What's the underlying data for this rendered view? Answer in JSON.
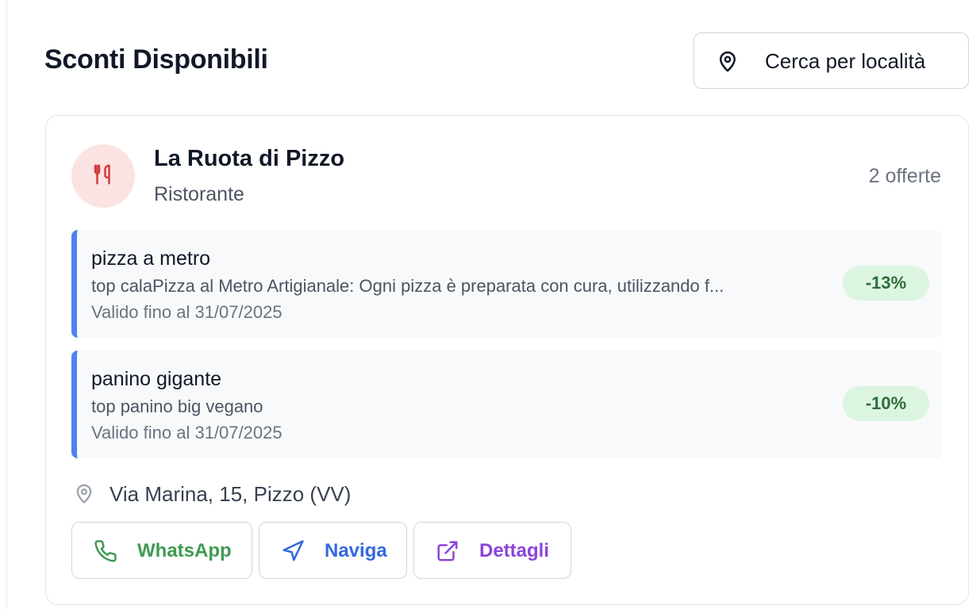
{
  "header": {
    "title": "Sconti Disponibili",
    "location_button_label": "Cerca per località"
  },
  "restaurant": {
    "name": "La Ruota di Pizzo",
    "type": "Ristorante",
    "offers_count": "2 offerte",
    "icon": "fork-knife-icon",
    "avatar_bg": "#fbe3e3",
    "icon_color": "#d33a3a"
  },
  "offers": [
    {
      "title": "pizza a metro",
      "description": "top calaPizza al Metro Artigianale: Ogni pizza è preparata con cura, utilizzando f...",
      "valid": "Valido fino al 31/07/2025",
      "discount": "-13%"
    },
    {
      "title": "panino gigante",
      "description": "top panino big vegano",
      "valid": "Valido fino al 31/07/2025",
      "discount": "-10%"
    }
  ],
  "address": "Via Marina, 15, Pizzo (VV)",
  "actions": {
    "whatsapp": {
      "label": "WhatsApp",
      "color": "#3f9a52",
      "icon": "phone-icon"
    },
    "navigate": {
      "label": "Naviga",
      "color": "#3468e0",
      "icon": "navigation-arrow-icon"
    },
    "details": {
      "label": "Dettagli",
      "color": "#8b45d9",
      "icon": "external-link-icon"
    }
  },
  "colors": {
    "accent_border": "#4f82ee",
    "badge_bg": "#dcf5e1",
    "badge_text": "#2f6b3b"
  }
}
